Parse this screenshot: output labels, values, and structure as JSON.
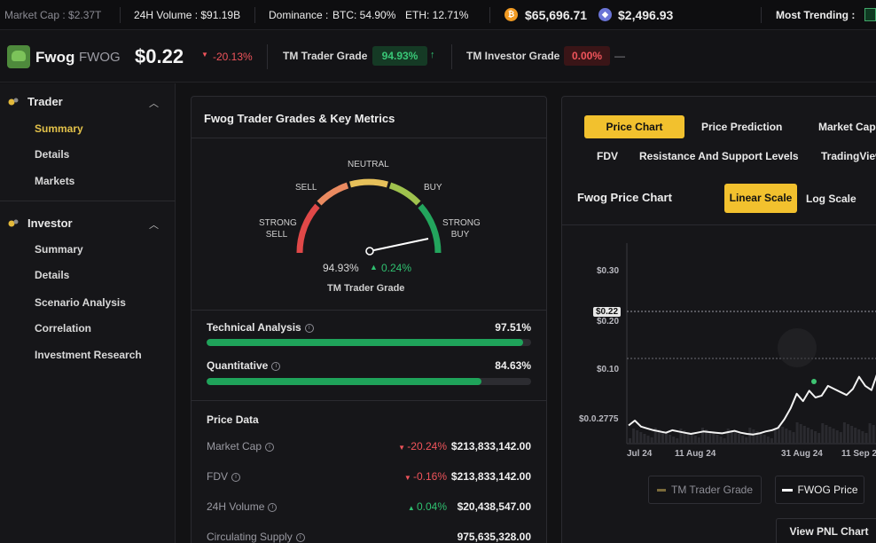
{
  "ticker": {
    "market_cap": "Market Cap : $2.37T",
    "volume_24h": "24H Volume : $91.19B",
    "dominance_label": "Dominance :",
    "dominance_btc": "BTC: 54.90%",
    "dominance_eth": "ETH: 12.71%",
    "btc_price": "$65,696.71",
    "eth_price": "$2,496.93",
    "most_trending": "Most Trending :"
  },
  "token": {
    "name": "Fwog",
    "symbol": "FWOG",
    "price": "$0.22",
    "change": "-20.13%",
    "trader_grade_label": "TM Trader Grade",
    "trader_grade_value": "94.93%",
    "investor_grade_label": "TM Investor Grade",
    "investor_grade_value": "0.00%",
    "investor_grade_change": "—"
  },
  "sidebar": {
    "sections": [
      {
        "label": "Trader",
        "items": [
          "Summary",
          "Details",
          "Markets"
        ]
      },
      {
        "label": "Investor",
        "items": [
          "Summary",
          "Details",
          "Scenario Analysis",
          "Correlation",
          "Investment Research"
        ]
      }
    ]
  },
  "grades_card": {
    "title": "Fwog Trader Grades & Key Metrics",
    "gauge": {
      "labels": {
        "strong_sell": [
          "STRONG",
          "SELL"
        ],
        "sell": "SELL",
        "neutral": "NEUTRAL",
        "buy": "BUY",
        "strong_buy": [
          "STRONG",
          "BUY"
        ]
      },
      "value_pct": 94.93,
      "value_text": "94.93%",
      "change_text": "0.24%",
      "caption": "TM Trader Grade"
    },
    "metrics": [
      {
        "label": "Technical Analysis",
        "value_text": "97.51%",
        "value": 97.51
      },
      {
        "label": "Quantitative",
        "value_text": "84.63%",
        "value": 84.63
      }
    ],
    "price_data_title": "Price Data",
    "price_data": [
      {
        "label": "Market Cap",
        "change": "-20.24%",
        "dir": "down",
        "value": "$213,833,142.00"
      },
      {
        "label": "FDV",
        "change": "-0.16%",
        "dir": "down",
        "value": "$213,833,142.00"
      },
      {
        "label": "24H Volume",
        "change": "0.04%",
        "dir": "up",
        "value": "$20,438,547.00"
      },
      {
        "label": "Circulating Supply",
        "change": "",
        "dir": "",
        "value": "975,635,328.00"
      }
    ]
  },
  "chart_card": {
    "tabs_row1": [
      "Price Chart",
      "Price Prediction",
      "Market Cap"
    ],
    "tabs_row2": [
      "FDV",
      "Resistance And Support Levels",
      "TradingView"
    ],
    "active_tab": "Price Chart",
    "title": "Fwog Price Chart",
    "scale_linear": "Linear Scale",
    "scale_log": "Log Scale",
    "legend_grade": "TM Trader Grade",
    "legend_price": "FWOG Price",
    "pnl_button": "View PNL Chart",
    "colors": {
      "accent": "#f2c12e",
      "up": "#2fc070",
      "down": "#f0545b"
    }
  },
  "chart_data": {
    "type": "line",
    "title": "Fwog Price Chart",
    "y_ticks": [
      "$0.30",
      "$0.20",
      "$0.10",
      "$0.0.2775"
    ],
    "current_price_label": "$0.22",
    "x_ticks": [
      "Jul 24",
      "11 Aug 24",
      "31 Aug 24",
      "11 Sep 2"
    ],
    "scale": "linear",
    "ylim": [
      0.0,
      0.33
    ],
    "series": [
      {
        "name": "FWOG Price",
        "points": [
          0.03,
          0.038,
          0.028,
          0.025,
          0.022,
          0.02,
          0.018,
          0.022,
          0.02,
          0.018,
          0.016,
          0.018,
          0.02,
          0.019,
          0.018,
          0.017,
          0.019,
          0.021,
          0.018,
          0.016,
          0.015,
          0.017,
          0.02,
          0.022,
          0.026,
          0.04,
          0.058,
          0.082,
          0.07,
          0.087,
          0.076,
          0.079,
          0.095,
          0.09,
          0.085,
          0.08,
          0.09,
          0.11,
          0.095,
          0.088,
          0.118,
          0.12,
          0.11
        ]
      }
    ]
  }
}
